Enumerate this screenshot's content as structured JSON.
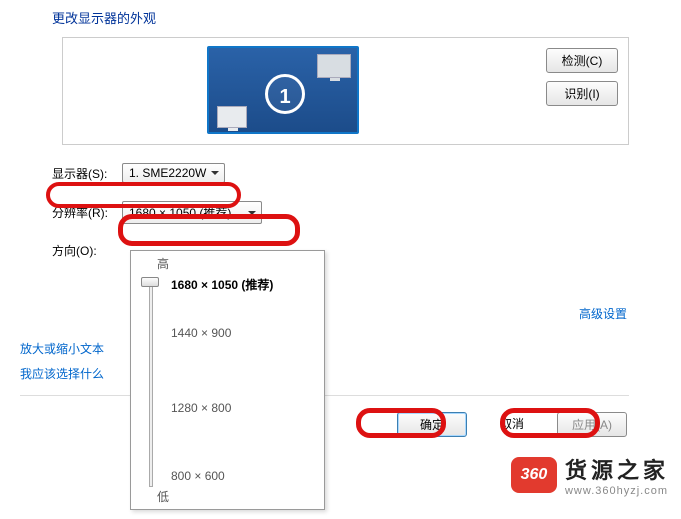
{
  "title": "更改显示器的外观",
  "monitor_number": "1",
  "side_buttons": {
    "detect": "检测(C)",
    "identify": "识别(I)"
  },
  "labels": {
    "display": "显示器(S):",
    "resolution": "分辨率(R):",
    "orientation": "方向(O):"
  },
  "display_selected": "1. SME2220W",
  "resolution_selected": "1680 × 1050 (推荐)",
  "links": {
    "advanced": "高级设置",
    "magnify": "放大或缩小文本",
    "which": "我应该选择什么"
  },
  "actions": {
    "ok": "确定",
    "cancel": "取消",
    "apply": "应用(A)"
  },
  "slider": {
    "top_label": "高",
    "bottom_label": "低",
    "options": [
      "1680 × 1050 (推荐)",
      "1440 × 900",
      "1280 × 800",
      "800 × 600"
    ]
  },
  "watermark": {
    "badge": "360",
    "title": "货源之家",
    "url": "www.360hyzj.com"
  }
}
